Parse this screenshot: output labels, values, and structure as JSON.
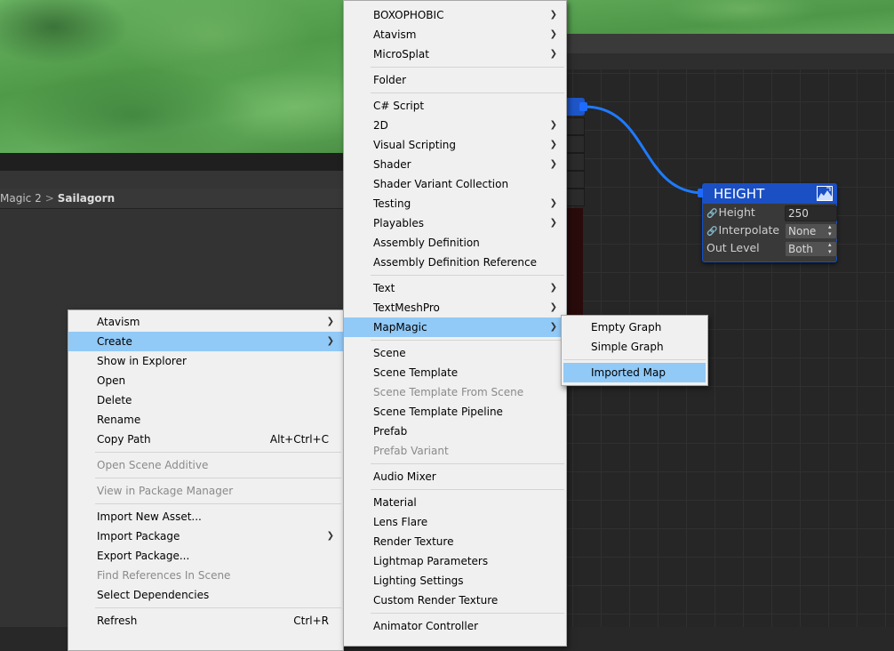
{
  "breadcrumb": {
    "items": [
      "Magic 2",
      "Sailagorn"
    ]
  },
  "height_node": {
    "title": "HEIGHT",
    "icon": "terrain-chart-icon",
    "rows": [
      {
        "label": "Height",
        "value": "250",
        "linked": true
      },
      {
        "label": "Interpolate",
        "value": "None",
        "linked": true
      },
      {
        "label": "Out Level",
        "value": "Both",
        "linked": false
      }
    ]
  },
  "context_menu": {
    "items": [
      {
        "label": "Atavism",
        "submenu": true
      },
      {
        "label": "Create",
        "submenu": true,
        "highlighted": true
      },
      {
        "label": "Show in Explorer"
      },
      {
        "label": "Open"
      },
      {
        "label": "Delete"
      },
      {
        "label": "Rename"
      },
      {
        "label": "Copy Path",
        "shortcut": "Alt+Ctrl+C"
      },
      {
        "separator": true
      },
      {
        "label": "Open Scene Additive",
        "disabled": true
      },
      {
        "separator": true
      },
      {
        "label": "View in Package Manager",
        "disabled": true
      },
      {
        "separator": true
      },
      {
        "label": "Import New Asset..."
      },
      {
        "label": "Import Package",
        "submenu": true
      },
      {
        "label": "Export Package..."
      },
      {
        "label": "Find References In Scene",
        "disabled": true
      },
      {
        "label": "Select Dependencies"
      },
      {
        "separator": true
      },
      {
        "label": "Refresh",
        "shortcut": "Ctrl+R"
      }
    ]
  },
  "create_menu": {
    "items": [
      {
        "label": "BOXOPHOBIC",
        "submenu": true
      },
      {
        "label": "Atavism",
        "submenu": true
      },
      {
        "label": "MicroSplat",
        "submenu": true
      },
      {
        "separator": true
      },
      {
        "label": "Folder"
      },
      {
        "separator": true
      },
      {
        "label": "C# Script"
      },
      {
        "label": "2D",
        "submenu": true
      },
      {
        "label": "Visual Scripting",
        "submenu": true
      },
      {
        "label": "Shader",
        "submenu": true
      },
      {
        "label": "Shader Variant Collection"
      },
      {
        "label": "Testing",
        "submenu": true
      },
      {
        "label": "Playables",
        "submenu": true
      },
      {
        "label": "Assembly Definition"
      },
      {
        "label": "Assembly Definition Reference"
      },
      {
        "separator": true
      },
      {
        "label": "Text",
        "submenu": true
      },
      {
        "label": "TextMeshPro",
        "submenu": true
      },
      {
        "label": "MapMagic",
        "submenu": true,
        "highlighted": true
      },
      {
        "separator": true
      },
      {
        "label": "Scene"
      },
      {
        "label": "Scene Template"
      },
      {
        "label": "Scene Template From Scene",
        "disabled": true
      },
      {
        "label": "Scene Template Pipeline"
      },
      {
        "label": "Prefab"
      },
      {
        "label": "Prefab Variant",
        "disabled": true
      },
      {
        "separator": true
      },
      {
        "label": "Audio Mixer"
      },
      {
        "separator": true
      },
      {
        "label": "Material"
      },
      {
        "label": "Lens Flare"
      },
      {
        "label": "Render Texture"
      },
      {
        "label": "Lightmap Parameters"
      },
      {
        "label": "Lighting Settings"
      },
      {
        "label": "Custom Render Texture"
      },
      {
        "separator": true
      },
      {
        "label": "Animator Controller"
      }
    ]
  },
  "mapmagic_menu": {
    "items": [
      {
        "label": "Empty Graph"
      },
      {
        "label": "Simple Graph"
      },
      {
        "separator": true
      },
      {
        "label": "Imported Map",
        "highlighted": true
      }
    ]
  },
  "colors": {
    "menu_bg": "#f0f0f0",
    "menu_highlight": "#91c9f7",
    "node_blue": "#1b4fc4",
    "connector_blue": "#1e7bff",
    "editor_bg": "#282828"
  }
}
